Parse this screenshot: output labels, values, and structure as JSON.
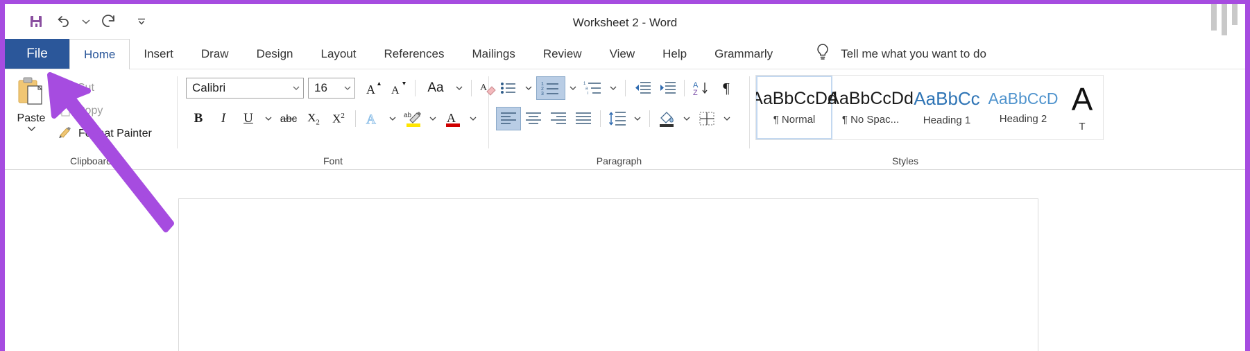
{
  "window": {
    "title": "Worksheet 2  -  Word",
    "accent_color": "#2b579a",
    "annotation_color": "#a64ce0"
  },
  "quick_access": {
    "items": [
      {
        "name": "save-icon",
        "label": "Save"
      },
      {
        "name": "undo-icon",
        "label": "Undo"
      },
      {
        "name": "undo-dropdown-icon",
        "label": "Undo options"
      },
      {
        "name": "redo-icon",
        "label": "Redo"
      },
      {
        "name": "customize-qat-icon",
        "label": "Customize Quick Access Toolbar"
      }
    ]
  },
  "tabs": {
    "file_label": "File",
    "items": [
      {
        "label": "Home",
        "active": true
      },
      {
        "label": "Insert",
        "active": false
      },
      {
        "label": "Draw",
        "active": false
      },
      {
        "label": "Design",
        "active": false
      },
      {
        "label": "Layout",
        "active": false
      },
      {
        "label": "References",
        "active": false
      },
      {
        "label": "Mailings",
        "active": false
      },
      {
        "label": "Review",
        "active": false
      },
      {
        "label": "View",
        "active": false
      },
      {
        "label": "Help",
        "active": false
      },
      {
        "label": "Grammarly",
        "active": false
      }
    ],
    "tell_me": "Tell me what you want to do"
  },
  "ribbon": {
    "clipboard": {
      "label": "Clipboard",
      "paste_label": "Paste",
      "cut_label": "Cut",
      "copy_label": "Copy",
      "format_painter_label": "Format Painter"
    },
    "font": {
      "label": "Font",
      "font_name": "Calibri",
      "font_size": "16",
      "buttons": [
        {
          "name": "grow-font-icon",
          "glyph": "A"
        },
        {
          "name": "shrink-font-icon",
          "glyph": "A"
        },
        {
          "name": "change-case-icon",
          "glyph": "Aa"
        },
        {
          "name": "clear-formatting-icon",
          "glyph": "A"
        },
        {
          "name": "bold-icon",
          "glyph": "B"
        },
        {
          "name": "italic-icon",
          "glyph": "I"
        },
        {
          "name": "underline-icon",
          "glyph": "U"
        },
        {
          "name": "strikethrough-icon",
          "glyph": "abc"
        },
        {
          "name": "subscript-icon",
          "glyph": "X₂"
        },
        {
          "name": "superscript-icon",
          "glyph": "X²"
        },
        {
          "name": "text-effects-icon",
          "glyph": "A"
        },
        {
          "name": "text-highlight-color-icon",
          "glyph": "ab"
        },
        {
          "name": "font-color-icon",
          "glyph": "A"
        }
      ],
      "highlight_color": "#ffe500",
      "font_color": "#d00000"
    },
    "paragraph": {
      "label": "Paragraph",
      "buttons": [
        {
          "name": "bullets-icon",
          "active": false
        },
        {
          "name": "numbering-icon",
          "active": true
        },
        {
          "name": "multilevel-list-icon",
          "active": false
        },
        {
          "name": "decrease-indent-icon",
          "active": false
        },
        {
          "name": "increase-indent-icon",
          "active": false
        },
        {
          "name": "sort-icon",
          "active": false
        },
        {
          "name": "show-formatting-marks-icon",
          "active": false
        },
        {
          "name": "align-left-icon",
          "active": true
        },
        {
          "name": "align-center-icon",
          "active": false
        },
        {
          "name": "align-right-icon",
          "active": false
        },
        {
          "name": "justify-icon",
          "active": false
        },
        {
          "name": "line-spacing-icon",
          "active": false
        },
        {
          "name": "shading-icon",
          "active": false
        },
        {
          "name": "borders-icon",
          "active": false
        }
      ]
    },
    "styles": {
      "label": "Styles",
      "items": [
        {
          "preview": "AaBbCcDd",
          "name": "¶ Normal",
          "kind": "normal",
          "selected": true
        },
        {
          "preview": "AaBbCcDd",
          "name": "¶ No Spac...",
          "kind": "normal",
          "selected": false
        },
        {
          "preview": "AaBbCc",
          "name": "Heading 1",
          "kind": "h1",
          "selected": false
        },
        {
          "preview": "AaBbCcD",
          "name": "Heading 2",
          "kind": "h2",
          "selected": false
        },
        {
          "preview": "A",
          "name": "T",
          "kind": "big",
          "selected": false
        }
      ]
    }
  }
}
